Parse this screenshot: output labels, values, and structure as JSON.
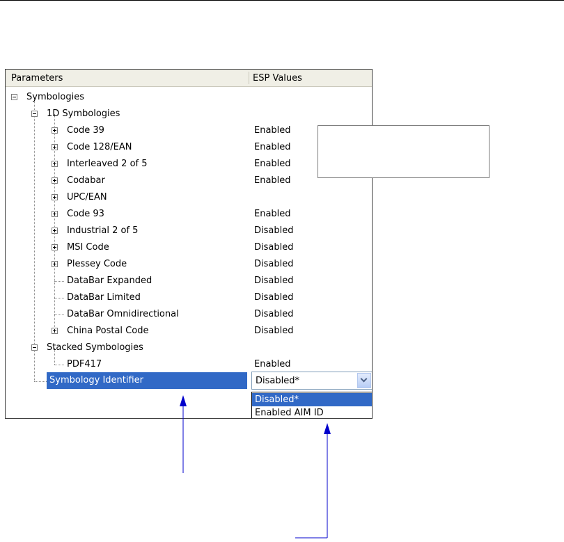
{
  "grid": {
    "header": {
      "parameters": "Parameters",
      "esp_values": "ESP Values"
    },
    "rows": [
      {
        "label": "Symbologies",
        "value": ""
      },
      {
        "label": "1D Symbologies",
        "value": ""
      },
      {
        "label": "Code 39",
        "value": "Enabled"
      },
      {
        "label": "Code 128/EAN",
        "value": "Enabled"
      },
      {
        "label": "Interleaved 2 of 5",
        "value": "Enabled"
      },
      {
        "label": "Codabar",
        "value": "Enabled"
      },
      {
        "label": "UPC/EAN",
        "value": ""
      },
      {
        "label": "Code 93",
        "value": "Enabled"
      },
      {
        "label": "Industrial 2 of 5",
        "value": "Disabled"
      },
      {
        "label": "MSI Code",
        "value": "Disabled"
      },
      {
        "label": "Plessey Code",
        "value": "Disabled"
      },
      {
        "label": "DataBar Expanded",
        "value": "Disabled"
      },
      {
        "label": "DataBar Limited",
        "value": "Disabled"
      },
      {
        "label": "DataBar Omnidirectional",
        "value": "Disabled"
      },
      {
        "label": "China Postal Code",
        "value": "Disabled"
      },
      {
        "label": "Stacked Symbologies",
        "value": ""
      },
      {
        "label": "PDF417",
        "value": "Enabled"
      }
    ],
    "selected_row": {
      "label": "Symbology Identifier"
    },
    "combo": {
      "value": "Disabled*",
      "icon": "chevron-down-icon"
    },
    "dropdown_options": [
      "Disabled*",
      "Enabled AIM ID"
    ]
  },
  "colors": {
    "selection": "#3169c6",
    "arrow": "#0000cc",
    "header_bg": "#f0efe6"
  }
}
